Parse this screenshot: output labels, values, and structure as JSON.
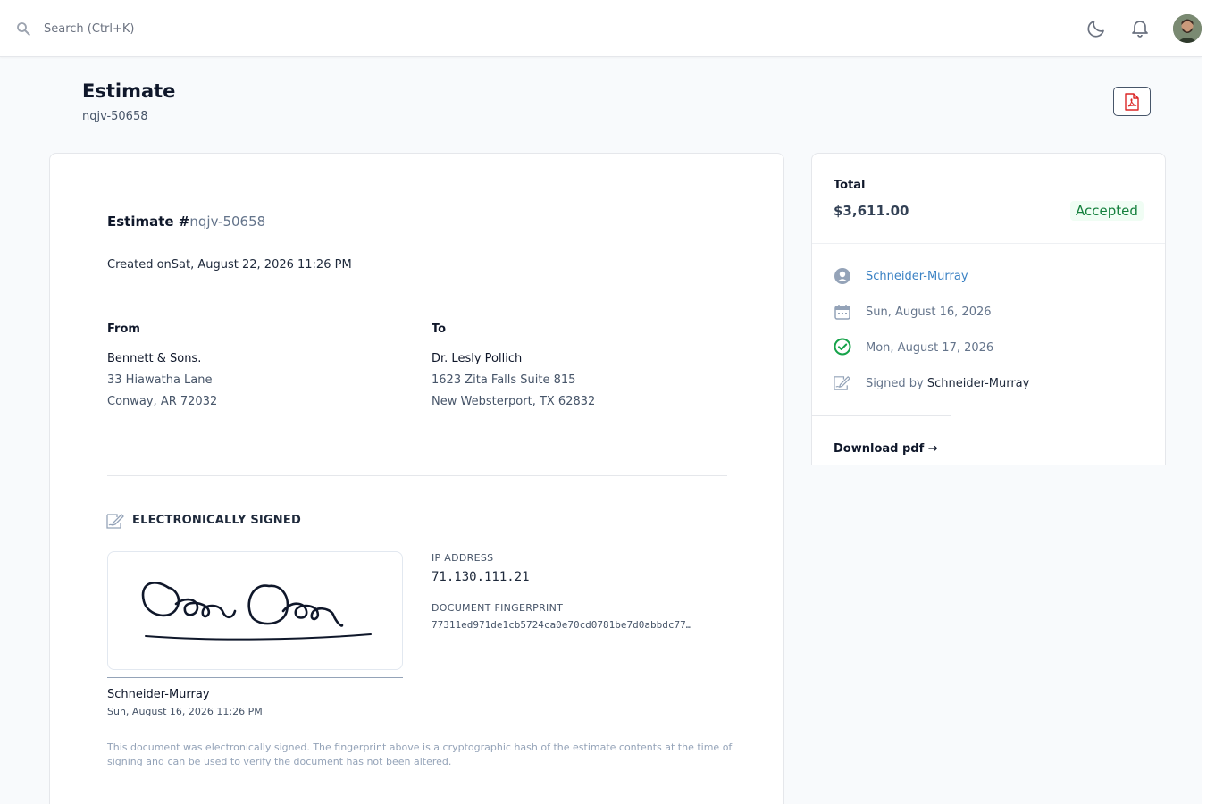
{
  "search": {
    "placeholder": "Search (Ctrl+K)"
  },
  "header": {
    "title": "Estimate",
    "subtitle": "nqjv-50658"
  },
  "document": {
    "heading_prefix": "Estimate #",
    "estimate_number": "nqjv-50658",
    "created_prefix": "Created on",
    "created_value": "Sat, August 22, 2026 11:26 PM",
    "from": {
      "label": "From",
      "name": "Bennett & Sons.",
      "line1": "33 Hiawatha Lane",
      "line2": "Conway, AR 72032"
    },
    "to": {
      "label": "To",
      "name": "Dr. Lesly Pollich",
      "line1": "1623 Zita Falls Suite 815",
      "line2": "New Websterport, TX 62832"
    },
    "esign": {
      "title": "ELECTRONICALLY SIGNED",
      "signer": "Schneider-Murray",
      "signed_at": "Sun, August 16, 2026 11:26 PM",
      "ip_label": "IP ADDRESS",
      "ip": "71.130.111.21",
      "fingerprint_label": "DOCUMENT FINGERPRINT",
      "fingerprint": "77311ed971de1cb5724ca0e70cd0781be7d0abbdc77…",
      "disclaimer": "This document was electronically signed. The fingerprint above is a cryptographic hash of the estimate contents at the time of signing and can be used to verify the document has not been altered."
    }
  },
  "sidebar": {
    "total_label": "Total",
    "total_amount": "$3,611.00",
    "status": "Accepted",
    "status_color": "#15803d",
    "customer": "Schneider-Murray",
    "date": "Sun, August 16, 2026",
    "accepted_date": "Mon, August 17, 2026",
    "signed_by_prefix": "Signed by",
    "signed_by": "Schneider-Murray",
    "download_label": "Download pdf →"
  },
  "icons": {
    "search": "search-icon",
    "moon": "moon-icon",
    "bell": "bell-icon",
    "pdf": "pdf-file-icon",
    "user": "user-circle-icon",
    "calendar": "calendar-icon",
    "check": "check-circle-icon",
    "signature": "signature-icon"
  },
  "colors": {
    "link": "#3b82c4",
    "accent_red": "#dc2626",
    "check_green": "#16a34a"
  }
}
